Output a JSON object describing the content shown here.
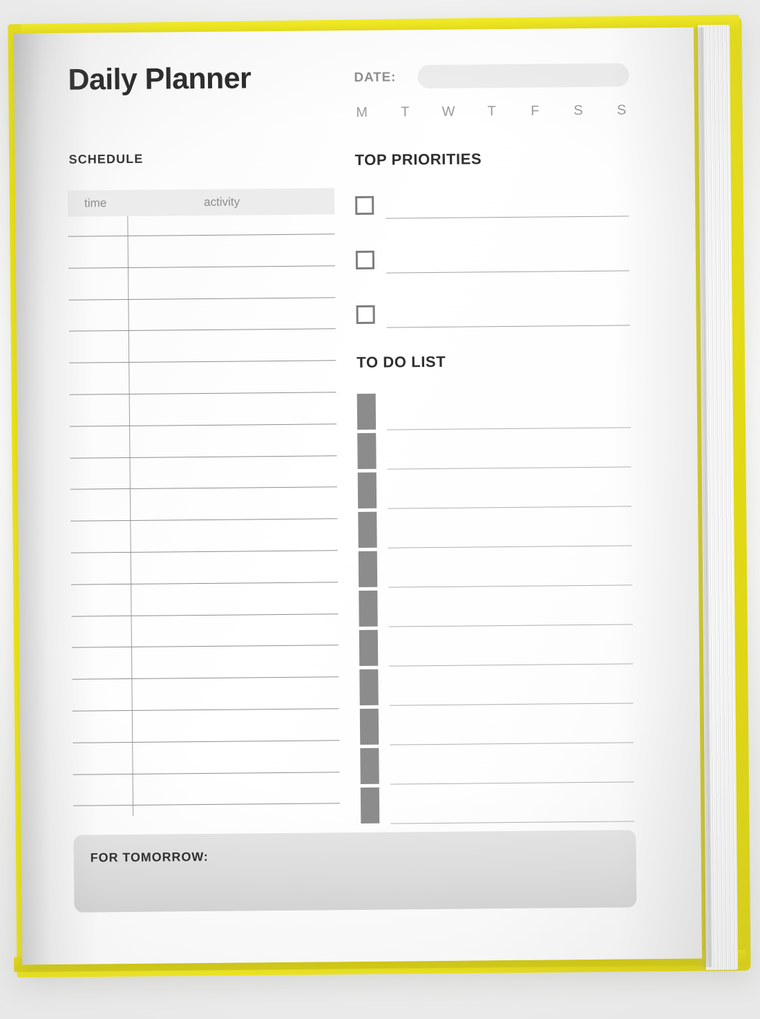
{
  "document": {
    "title": "Daily Planner",
    "type": "daily-planner-notebook-page"
  },
  "date_row": {
    "label": "DATE:",
    "field_value": "",
    "weekdays": [
      "M",
      "T",
      "W",
      "T",
      "F",
      "S",
      "S"
    ]
  },
  "schedule": {
    "heading": "SCHEDULE",
    "columns": [
      "time",
      "activity"
    ],
    "row_count": 19,
    "rows": [
      {
        "time": "",
        "activity": ""
      },
      {
        "time": "",
        "activity": ""
      },
      {
        "time": "",
        "activity": ""
      },
      {
        "time": "",
        "activity": ""
      },
      {
        "time": "",
        "activity": ""
      },
      {
        "time": "",
        "activity": ""
      },
      {
        "time": "",
        "activity": ""
      },
      {
        "time": "",
        "activity": ""
      },
      {
        "time": "",
        "activity": ""
      },
      {
        "time": "",
        "activity": ""
      },
      {
        "time": "",
        "activity": ""
      },
      {
        "time": "",
        "activity": ""
      },
      {
        "time": "",
        "activity": ""
      },
      {
        "time": "",
        "activity": ""
      },
      {
        "time": "",
        "activity": ""
      },
      {
        "time": "",
        "activity": ""
      },
      {
        "time": "",
        "activity": ""
      },
      {
        "time": "",
        "activity": ""
      },
      {
        "time": "",
        "activity": ""
      }
    ]
  },
  "priorities": {
    "heading": "TOP PRIORITIES",
    "items": [
      {
        "checked": false,
        "text": ""
      },
      {
        "checked": false,
        "text": ""
      },
      {
        "checked": false,
        "text": ""
      }
    ]
  },
  "todo": {
    "heading": "TO DO LIST",
    "items": [
      {
        "checked": false,
        "text": ""
      },
      {
        "checked": false,
        "text": ""
      },
      {
        "checked": false,
        "text": ""
      },
      {
        "checked": false,
        "text": ""
      },
      {
        "checked": false,
        "text": ""
      },
      {
        "checked": false,
        "text": ""
      },
      {
        "checked": false,
        "text": ""
      },
      {
        "checked": false,
        "text": ""
      },
      {
        "checked": false,
        "text": ""
      },
      {
        "checked": false,
        "text": ""
      },
      {
        "checked": false,
        "text": ""
      }
    ]
  },
  "tomorrow": {
    "label": "FOR TOMORROW:",
    "text": ""
  },
  "colors": {
    "cover_yellow": "#ECE31A",
    "todo_box_gray": "#8C8C8C",
    "header_band_gray": "#ECECEC",
    "tomorrow_box_gray": "#DEDEDE",
    "date_field_gray": "#EDEDED",
    "ink_black": "#2B2B2B",
    "rule_gray": "#8F8F8F"
  }
}
